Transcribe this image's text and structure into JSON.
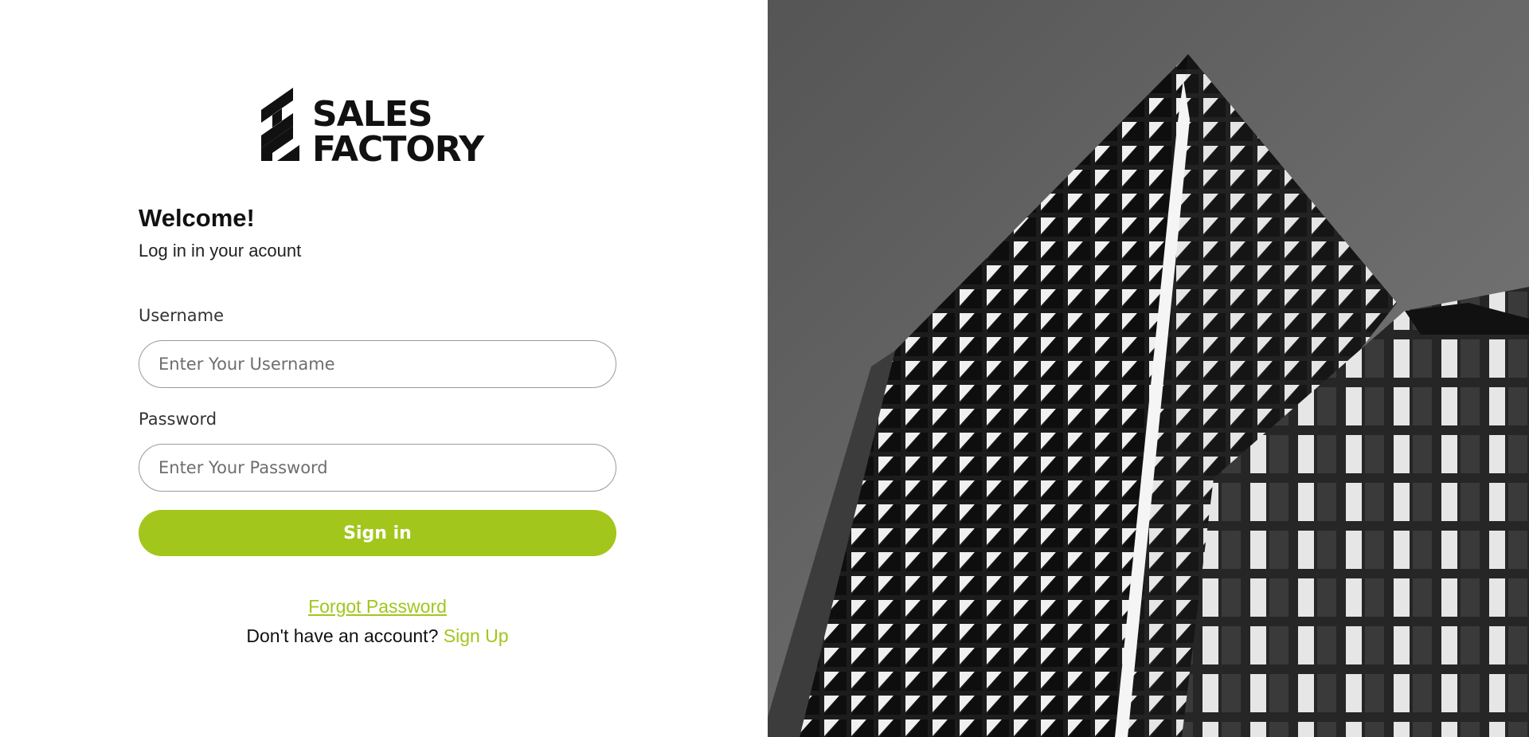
{
  "brand": {
    "logo_line1": "SALES",
    "logo_line2": "FACTORY",
    "accent_color": "#a2c61c"
  },
  "login": {
    "heading": "Welcome!",
    "subheading": "Log in in your acount",
    "username_label": "Username",
    "username_placeholder": "Enter Your Username",
    "username_value": "",
    "password_label": "Password",
    "password_placeholder": "Enter Your Password",
    "password_value": "",
    "submit_label": "Sign in",
    "forgot_link": "Forgot Password",
    "signup_prompt": "Don't have an account?",
    "signup_link": "Sign Up"
  },
  "hero": {
    "image": "black-and-white skyscraper",
    "icon": "building-photo"
  }
}
